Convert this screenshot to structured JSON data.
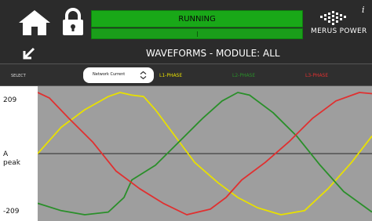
{
  "status": {
    "text": "RUNNING",
    "color": "#19a818"
  },
  "logo": {
    "text": "MERUS POWER"
  },
  "header": {
    "title": "WAVEFORMS - MODULE: ALL"
  },
  "select": {
    "label": "SELECT",
    "value": "Network Current"
  },
  "phases": [
    {
      "label": "L1-PHASE",
      "color": "#e8e000"
    },
    {
      "label": "L2-PHASE",
      "color": "#2a8f2a"
    },
    {
      "label": "L3-PHASE",
      "color": "#e03030"
    }
  ],
  "axis": {
    "max_label": "209",
    "unit_label_1": "A",
    "unit_label_2": "peak",
    "min_label": "-209"
  },
  "chart_data": {
    "type": "line",
    "ylim": [
      -209,
      209
    ],
    "series": [
      {
        "name": "L1-PHASE",
        "color": "#e8e000",
        "x": [
          0,
          30,
          60,
          90,
          105,
          120,
          135,
          150,
          175,
          200,
          230,
          255,
          280,
          310,
          340,
          370,
          400,
          426
        ],
        "y": [
          0,
          90,
          150,
          195,
          209,
          200,
          195,
          150,
          60,
          -30,
          -100,
          -150,
          -185,
          -209,
          -195,
          -120,
          -30,
          60
        ]
      },
      {
        "name": "L2-PHASE",
        "color": "#2a8f2a",
        "x": [
          0,
          30,
          60,
          90,
          110,
          120,
          150,
          180,
          210,
          235,
          255,
          270,
          300,
          330,
          360,
          390,
          426
        ],
        "y": [
          -170,
          -195,
          -209,
          -200,
          -150,
          -90,
          -40,
          40,
          120,
          180,
          209,
          200,
          140,
          60,
          -40,
          -130,
          -200
        ]
      },
      {
        "name": "L3-PHASE",
        "color": "#e03030",
        "x": [
          0,
          15,
          40,
          70,
          100,
          130,
          160,
          190,
          220,
          240,
          260,
          290,
          320,
          350,
          380,
          410,
          426
        ],
        "y": [
          209,
          190,
          120,
          40,
          -60,
          -120,
          -170,
          -209,
          -190,
          -150,
          -90,
          -30,
          40,
          120,
          180,
          209,
          205
        ]
      }
    ]
  }
}
